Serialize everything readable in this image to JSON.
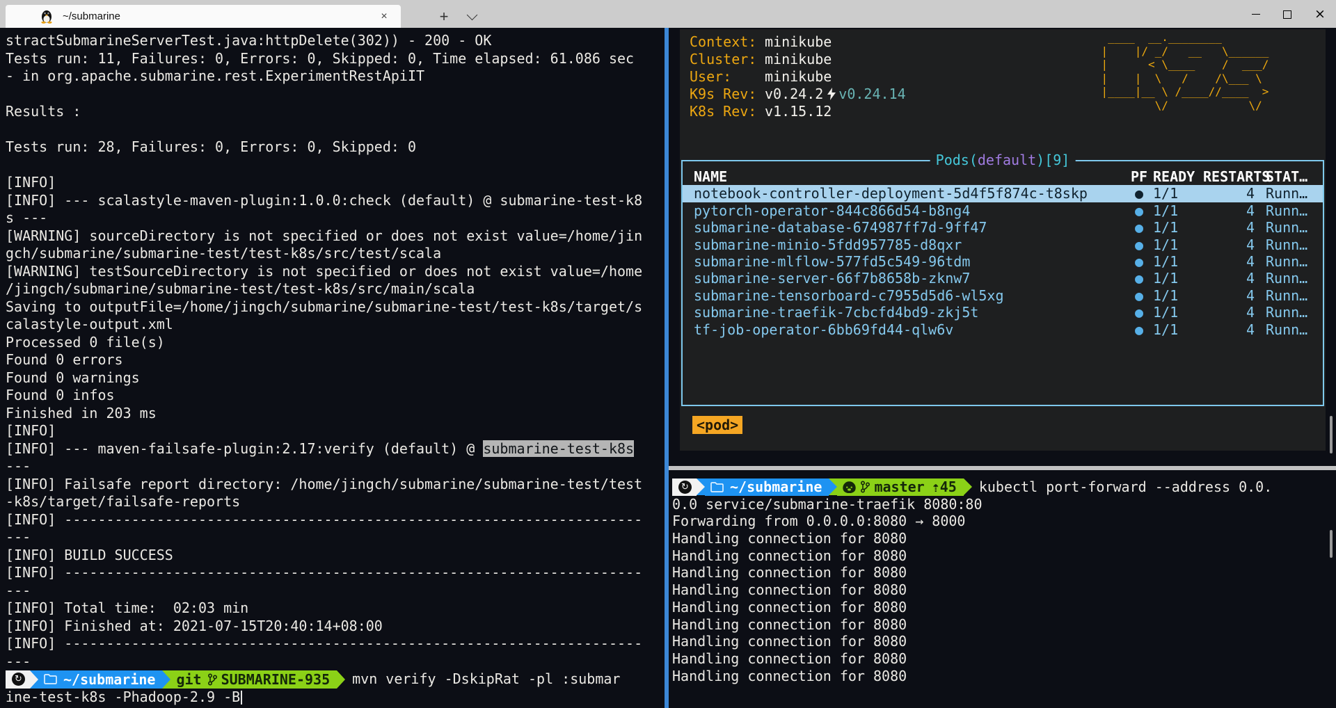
{
  "window": {
    "tab_title": "~/submarine",
    "tab_close": "×",
    "new_tab": "+"
  },
  "left_terminal": {
    "lines": [
      "stractSubmarineServerTest.java:httpDelete(302)) - 200 - OK",
      "Tests run: 11, Failures: 0, Errors: 0, Skipped: 0, Time elapsed: 61.086 sec",
      "- in org.apache.submarine.rest.ExperimentRestApiIT",
      "",
      "Results :",
      "",
      "Tests run: 28, Failures: 0, Errors: 0, Skipped: 0",
      "",
      "[INFO]",
      "[INFO] --- scalastyle-maven-plugin:1.0.0:check (default) @ submarine-test-k8",
      "s ---",
      "[WARNING] sourceDirectory is not specified or does not exist value=/home/jin",
      "gch/submarine/submarine-test/test-k8s/src/test/scala",
      "[WARNING] testSourceDirectory is not specified or does not exist value=/home",
      "/jingch/submarine/submarine-test/test-k8s/src/main/scala",
      "Saving to outputFile=/home/jingch/submarine/submarine-test/test-k8s/target/s",
      "calastyle-output.xml",
      "Processed 0 file(s)",
      "Found 0 errors",
      "Found 0 warnings",
      "Found 0 infos",
      "Finished in 203 ms",
      "[INFO]",
      {
        "parts": [
          {
            "t": "[INFO] --- maven-failsafe-plugin:2.17:verify (default) @ "
          },
          {
            "t": "submarine-test-k8s",
            "hl": true
          }
        ]
      },
      "---",
      "[INFO] Failsafe report directory: /home/jingch/submarine/submarine-test/test",
      "-k8s/target/failsafe-reports",
      "[INFO] ---------------------------------------------------------------------",
      "---",
      "[INFO] BUILD SUCCESS",
      "[INFO] ---------------------------------------------------------------------",
      "---",
      "[INFO] Total time:  02:03 min",
      "[INFO] Finished at: 2021-07-15T20:40:14+08:00",
      "[INFO] ---------------------------------------------------------------------",
      "---"
    ],
    "prompt": {
      "cwd": "~/submarine",
      "git_word": "git",
      "branch": "SUBMARINE-935",
      "command": "mvn verify -DskipRat -pl :submar"
    },
    "command_wrap": "ine-test-k8s -Phadoop-2.9 -B"
  },
  "k9s": {
    "info": {
      "context_label": "Context:",
      "context": "minikube",
      "cluster_label": "Cluster:",
      "cluster": "minikube",
      "user_label": "User:",
      "user": "minikube",
      "k9s_rev_label": "K9s Rev:",
      "k9s_rev": "v0.24.2",
      "k9s_rev_upgrade": "v0.24.14",
      "k8s_rev_label": "K8s Rev:",
      "k8s_rev": "v1.15.12"
    },
    "logo_lines": [
      " ____  __.________        ",
      "|    |/ _/   __   \\______ ",
      "|      < \\____    /  ___/ ",
      "|    |  \\   /    /\\___ \\  ",
      "|____|__ \\ /____//____  > ",
      "        \\/            \\/  "
    ],
    "pods": {
      "title_pre": "Pods(",
      "title_ns": "default",
      "title_post": ")[9]",
      "headers": {
        "name": "NAME",
        "pf": "PF",
        "ready": "READY",
        "restarts": "RESTARTS",
        "status": "STAT…"
      },
      "rows": [
        {
          "name": "notebook-controller-deployment-5d4f5f874c-t8skp",
          "pf": "●",
          "ready": "1/1",
          "restarts": "4",
          "status": "Runn…",
          "selected": true
        },
        {
          "name": "pytorch-operator-844c866d54-b8ng4",
          "pf": "●",
          "ready": "1/1",
          "restarts": "4",
          "status": "Runn…"
        },
        {
          "name": "submarine-database-674987ff7d-9ff47",
          "pf": "●",
          "ready": "1/1",
          "restarts": "4",
          "status": "Runn…"
        },
        {
          "name": "submarine-minio-5fdd957785-d8qxr",
          "pf": "●",
          "ready": "1/1",
          "restarts": "4",
          "status": "Runn…"
        },
        {
          "name": "submarine-mlflow-577fd5c549-96tdm",
          "pf": "●",
          "ready": "1/1",
          "restarts": "4",
          "status": "Runn…"
        },
        {
          "name": "submarine-server-66f7b8658b-zknw7",
          "pf": "●",
          "ready": "1/1",
          "restarts": "4",
          "status": "Runn…"
        },
        {
          "name": "submarine-tensorboard-c7955d5d6-wl5xg",
          "pf": "●",
          "ready": "1/1",
          "restarts": "4",
          "status": "Runn…"
        },
        {
          "name": "submarine-traefik-7cbcfd4bd9-zkj5t",
          "pf": "●",
          "ready": "1/1",
          "restarts": "4",
          "status": "Runn…"
        },
        {
          "name": "tf-job-operator-6bb69fd44-qlw6v",
          "pf": "●",
          "ready": "1/1",
          "restarts": "4",
          "status": "Runn…"
        }
      ]
    },
    "mode_badge": "<pod>"
  },
  "bottom_terminal": {
    "prompt": {
      "cwd": "~/submarine",
      "branch": "master",
      "ahead": "⇡45",
      "command": "kubectl port-forward --address 0.0."
    },
    "lines": [
      "0.0 service/submarine-traefik 8080:80",
      "Forwarding from 0.0.0.0:8080 → 8000",
      "Handling connection for 8080",
      "Handling connection for 8080",
      "Handling connection for 8080",
      "Handling connection for 8080",
      "Handling connection for 8080",
      "Handling connection for 8080",
      "Handling connection for 8080",
      "Handling connection for 8080",
      "Handling connection for 8080"
    ]
  },
  "colors": {
    "terminal_bg": "#0c0e15",
    "terminal_fg": "#ebe9e4",
    "k9s_bg": "#1e1f20",
    "k9s_orange": "#eda711",
    "k9s_teal": "#69b4b4",
    "pods_border": "#7ec8ec",
    "pod_row": "#85c9ee",
    "pod_selected_bg": "#a9d3ee",
    "prompt_blue": "#1e93f2",
    "prompt_green": "#8bd117",
    "focus_divider": "#3c87d6",
    "badge_orange": "#f5a623"
  }
}
